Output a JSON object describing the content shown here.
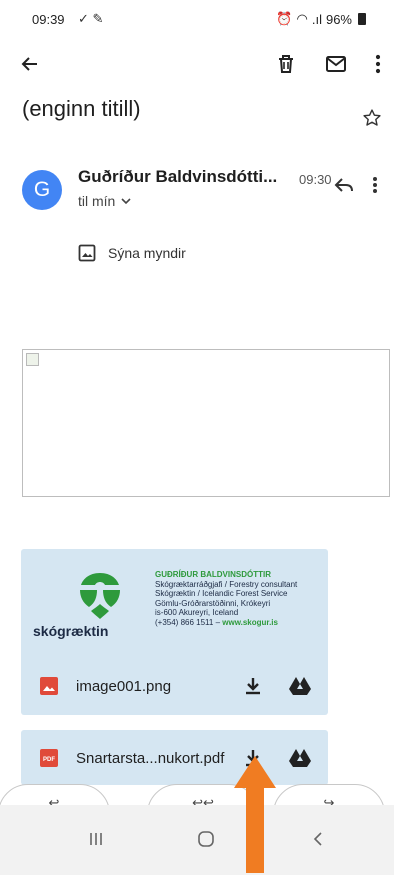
{
  "status_bar": {
    "time": "09:39",
    "battery": "96%"
  },
  "email": {
    "subject": "(enginn titill)",
    "sender_initial": "G",
    "sender": "Guðríður Baldvinsdótti...",
    "time": "09:30",
    "recipient": "til mín",
    "show_images": "Sýna myndir"
  },
  "signature": {
    "logo_text": "skógræktin",
    "name": "GUÐRÍÐUR BALDVINSDÓTTIR",
    "line1": "Skógræktarráðgjafi / Forestry consultant",
    "line2": "Skógræktin / Icelandic Forest Service",
    "line3": "Gömlu-Gróðrarstöðinni, Krókeyri",
    "line4": "is-600 Akureyri, Iceland",
    "phone": "(+354) 866 1511",
    "web": "www.skogur.is"
  },
  "attachments": [
    {
      "name": "image001.png",
      "type": "image"
    },
    {
      "name": "Snartarsta...nukort.pdf",
      "type": "pdf",
      "type_label": "PDF"
    }
  ],
  "colors": {
    "accent": "#4285f4",
    "attachment_bg": "#d5e6f2",
    "arrow": "#f07c22",
    "brand_green": "#2e9a3c"
  }
}
